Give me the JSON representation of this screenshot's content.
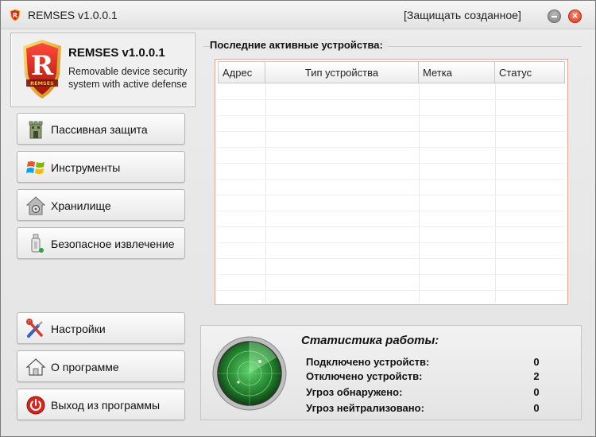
{
  "window": {
    "title": "REMSES v1.0.0.1",
    "protect_link": "[Защищать созданное]"
  },
  "logo": {
    "letter": "R",
    "ribbon": "REMSES",
    "title": "REMSES v1.0.0.1",
    "description": "Removable device security system with active defense"
  },
  "nav": {
    "passive": "Пассивная защита",
    "tools": "Инструменты",
    "storage": "Хранилище",
    "eject": "Безопасное извлечение",
    "settings": "Настройки",
    "about": "О программе",
    "exit": "Выход из программы"
  },
  "devices": {
    "title": "Последние активные устройства:",
    "columns": [
      "Адрес",
      "Тип устройства",
      "Метка",
      "Статус"
    ],
    "rows": []
  },
  "stats": {
    "title": "Статистика работы:",
    "rows": [
      {
        "label": "Подключено устройств:",
        "value": "0"
      },
      {
        "label": "Отключено устройств:",
        "value": "2"
      },
      {
        "label": "Угроз обнаружено:",
        "value": "0"
      },
      {
        "label": "Угроз нейтрализовано:",
        "value": "0"
      }
    ]
  },
  "icons": {
    "app": "remses-shield-icon",
    "passive": "castle-tower-icon",
    "tools": "windows-logo-icon",
    "storage": "home-safe-icon",
    "eject": "usb-drive-icon",
    "settings": "wrench-screwdriver-icon",
    "about": "house-icon",
    "exit": "power-icon",
    "radar": "radar-icon"
  },
  "colors": {
    "shield_red": "#d8261c",
    "shield_gold": "#f2c230",
    "list_border": "#e0a898",
    "radar_green": "#2f8f3a",
    "close_red": "#d9361a"
  }
}
